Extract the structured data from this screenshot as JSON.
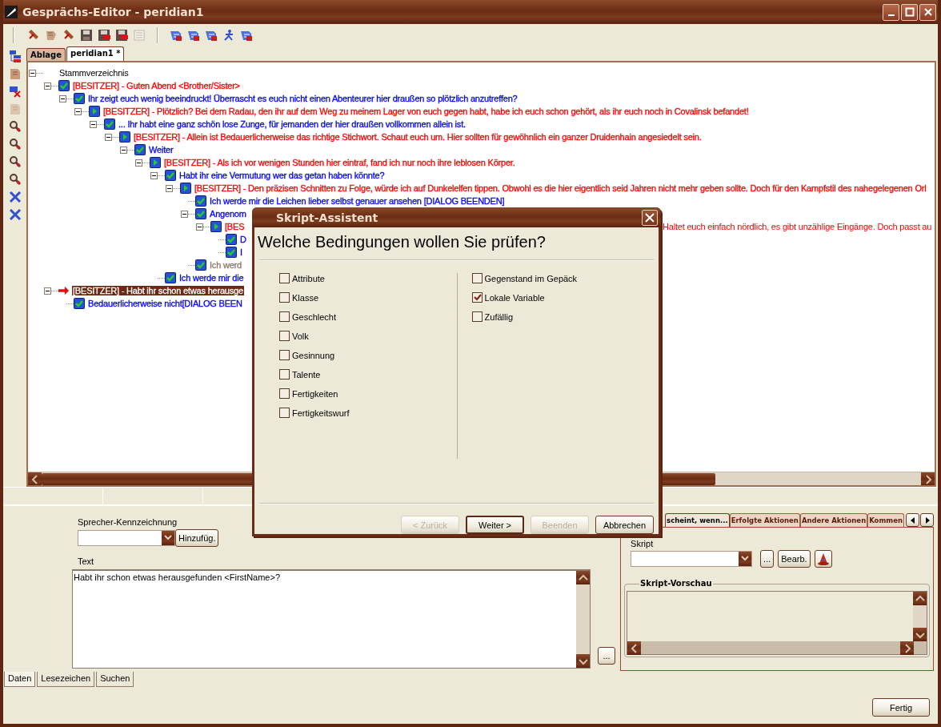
{
  "window": {
    "title": "Gesprächs-Editor - peridian1"
  },
  "toolbar": [
    {
      "kind": "scroll-cut",
      "disabled": false
    },
    {
      "kind": "scroll",
      "disabled": false
    },
    {
      "kind": "scroll-cut",
      "disabled": false
    },
    {
      "kind": "floppy",
      "disabled": false
    },
    {
      "kind": "floppy-red",
      "disabled": false
    },
    {
      "kind": "floppy-red",
      "disabled": false
    },
    {
      "kind": "list",
      "disabled": true
    },
    {
      "kind": "sep"
    },
    {
      "kind": "blue-scroll",
      "disabled": false
    },
    {
      "kind": "blue-scroll",
      "disabled": false
    },
    {
      "kind": "blue-scroll",
      "disabled": false
    },
    {
      "kind": "figure",
      "disabled": false
    },
    {
      "kind": "blue-scroll",
      "disabled": false
    }
  ],
  "side_toolbar": [
    {
      "kind": "tree",
      "disabled": false
    },
    {
      "kind": "page",
      "disabled": false
    },
    {
      "kind": "delete",
      "disabled": false
    },
    {
      "kind": "page",
      "disabled": true
    },
    {
      "kind": "magnifier",
      "disabled": false
    },
    {
      "kind": "magnifier",
      "disabled": false
    },
    {
      "kind": "magnifier",
      "disabled": false
    },
    {
      "kind": "magnifier",
      "disabled": false
    },
    {
      "kind": "cross",
      "disabled": false
    },
    {
      "kind": "cross",
      "disabled": false
    }
  ],
  "document_tabs": [
    {
      "label": "Ablage",
      "selected": false
    },
    {
      "label": "peridian1 *",
      "selected": true
    }
  ],
  "tree": {
    "label": "Stammverzeichnis",
    "expanded": true,
    "children": [
      {
        "text": "[BESITZER] - Guten Abend <Brother/Sister>",
        "color": "#ff0000",
        "kind": "check",
        "selected": false,
        "expanded": true,
        "children": [
          {
            "text": "Ihr zeigt euch wenig beeindruckt! Überrascht es euch nicht einen Abenteurer hier draußen so plötzlich anzutreffen?",
            "color": "#0000ff",
            "kind": "check",
            "selected": false,
            "expanded": true,
            "children": [
              {
                "text": "[BESITZER] - Plötzlich? Bei dem Radau, den ihr auf dem Weg zu meinem Lager von euch gegen habt, habe ich euch schon gehört, als ihr euch noch in Covalinsk befandet!",
                "color": "#ff0000",
                "kind": "play",
                "selected": false,
                "expanded": true,
                "children": [
                  {
                    "text": "... Ihr habt eine ganz schön lose Zunge, für jemanden der hier draußen vollkommen allein ist.",
                    "color": "#0000ff",
                    "kind": "check",
                    "selected": false,
                    "expanded": true,
                    "children": [
                      {
                        "text": "[BESITZER] - Allein ist Bedauerlicherweise das richtige Stichwort. Schaut euch um. Hier sollten für gewöhnlich ein ganzer Druidenhain angesiedelt sein.",
                        "color": "#ff0000",
                        "kind": "play",
                        "selected": false,
                        "expanded": true,
                        "children": [
                          {
                            "text": "Weiter",
                            "color": "#0000ff",
                            "kind": "check",
                            "selected": false,
                            "expanded": true,
                            "children": [
                              {
                                "text": "[BESITZER] - Als ich vor wenigen Stunden hier eintraf, fand ich nur noch ihre leblosen Körper.",
                                "color": "#ff0000",
                                "kind": "play",
                                "selected": false,
                                "expanded": true,
                                "children": [
                                  {
                                    "text": "Habt ihr eine Vermutung wer das getan haben könnte?",
                                    "color": "#0000ff",
                                    "kind": "check",
                                    "selected": false,
                                    "expanded": true,
                                    "children": [
                                      {
                                        "text": "[BESITZER] - Den präzisen Schnitten zu Folge, würde ich auf Dunkelelfen tippen. Obwohl es die hier eigentlich seid Jahren nicht mehr geben sollte. Doch für den Kampfstil des nahegelegenen Orl",
                                        "color": "#ff0000",
                                        "kind": "play",
                                        "selected": false,
                                        "expanded": true,
                                        "children": [
                                          {
                                            "text": "Ich werde mir die Leichen lieber selbst genauer ansehen [DIALOG BEENDEN]",
                                            "color": "#0000ff",
                                            "kind": "check",
                                            "selected": false
                                          },
                                          {
                                            "text": "Angenom",
                                            "color": "#0000ff",
                                            "kind": "check",
                                            "selected": false,
                                            "expanded": true,
                                            "children": [
                                              {
                                                "text": "[BES",
                                                "tail": "Haltet euch einfach nördlich, es gibt unzählige Eingänge. Doch passt au",
                                                "color": "#ff0000",
                                                "kind": "play",
                                                "selected": false,
                                                "expanded": true,
                                                "children": [
                                                  {
                                                    "text": "D",
                                                    "color": "#0000ff",
                                                    "kind": "check",
                                                    "selected": false
                                                  },
                                                  {
                                                    "text": "I",
                                                    "color": "#0000ff",
                                                    "kind": "check",
                                                    "selected": false
                                                  }
                                                ]
                                              }
                                            ]
                                          },
                                          {
                                            "text": "Ich werd",
                                            "color": "#8a7866",
                                            "kind": "check",
                                            "selected": false
                                          }
                                        ]
                                      }
                                    ]
                                  },
                                  {
                                    "text": "Ich werde mir die",
                                    "color": "#0000ff",
                                    "kind": "check",
                                    "selected": false
                                  }
                                ]
                              }
                            ]
                          }
                        ]
                      }
                    ]
                  }
                ]
              }
            ]
          }
        ]
      },
      {
        "text": "[BESITZER] - Habt ihr schon etwas herausge",
        "kind": "arrow",
        "selected": true,
        "expanded": true,
        "children": [
          {
            "text": "Bedauerlicherweise nicht[DIALOG BEEN",
            "color": "#0000ff",
            "kind": "check",
            "selected": false
          }
        ]
      }
    ]
  },
  "data_panel": {
    "speaker_label": "Sprecher-Kennzeichnung",
    "add_button": "Hinzufüg.",
    "text_label": "Text",
    "text_value": "Habt ihr schon etwas herausgefunden <FirstName>?",
    "more_button": "...",
    "tabs": [
      {
        "label": "Daten",
        "selected": true
      },
      {
        "label": "Lesezeichen",
        "selected": false
      },
      {
        "label": "Suchen",
        "selected": false
      }
    ]
  },
  "script_panel": {
    "tabs": [
      {
        "label": "scheint, wenn...",
        "selected": true
      },
      {
        "label": "Erfolgte Aktionen",
        "selected": false
      },
      {
        "label": "Andere Aktionen",
        "selected": false
      },
      {
        "label": "Kommen",
        "selected": false
      }
    ],
    "script_label": "Skript",
    "browse_button": "...",
    "edit_button": "Bearb.",
    "preview_label": "Skript-Vorschau"
  },
  "finish_button": "Fertig",
  "dialog": {
    "title": "Skript-Assistent",
    "heading": "Welche Bedingungen wollen Sie prüfen?",
    "left_options": [
      {
        "label": "Attribute",
        "checked": false
      },
      {
        "label": "Klasse",
        "checked": false
      },
      {
        "label": "Geschlecht",
        "checked": false
      },
      {
        "label": "Volk",
        "checked": false
      },
      {
        "label": "Gesinnung",
        "checked": false
      },
      {
        "label": "Talente",
        "checked": false
      },
      {
        "label": "Fertigkeiten",
        "checked": false
      },
      {
        "label": "Fertigkeitswurf",
        "checked": false
      }
    ],
    "right_options": [
      {
        "label": "Gegenstand im Gepäck",
        "checked": false
      },
      {
        "label": "Lokale Variable",
        "checked": true
      },
      {
        "label": "Zufällig",
        "checked": false
      }
    ],
    "buttons": [
      {
        "label": "< Zurück",
        "disabled": true,
        "default": false
      },
      {
        "label": "Weiter >",
        "disabled": false,
        "default": true
      },
      {
        "label": "Beenden",
        "disabled": true,
        "default": false
      },
      {
        "label": "Abbrechen",
        "disabled": false,
        "default": false
      }
    ]
  }
}
